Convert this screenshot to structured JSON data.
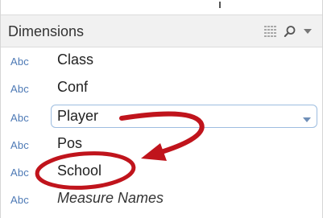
{
  "panel": {
    "title": "Dimensions",
    "tools": {
      "list_icon": "list-view-icon",
      "search_icon": "search-icon",
      "menu_icon": "chevron-down-icon"
    }
  },
  "fields": [
    {
      "type": "Abc",
      "name": "Class",
      "italic": false,
      "selected": false
    },
    {
      "type": "Abc",
      "name": "Conf",
      "italic": false,
      "selected": false
    },
    {
      "type": "Abc",
      "name": "Player",
      "italic": false,
      "selected": true
    },
    {
      "type": "Abc",
      "name": "Pos",
      "italic": false,
      "selected": false
    },
    {
      "type": "Abc",
      "name": "School",
      "italic": false,
      "selected": false
    },
    {
      "type": "Abc",
      "name": "Measure Names",
      "italic": true,
      "selected": false
    }
  ],
  "annotation": {
    "color": "#c0141c",
    "shape": "arrow-from-player-to-circled-school"
  },
  "colors": {
    "type_label": "#4d79b5",
    "selection_border": "#9dbde0",
    "header_bg": "#f1f1f1"
  }
}
